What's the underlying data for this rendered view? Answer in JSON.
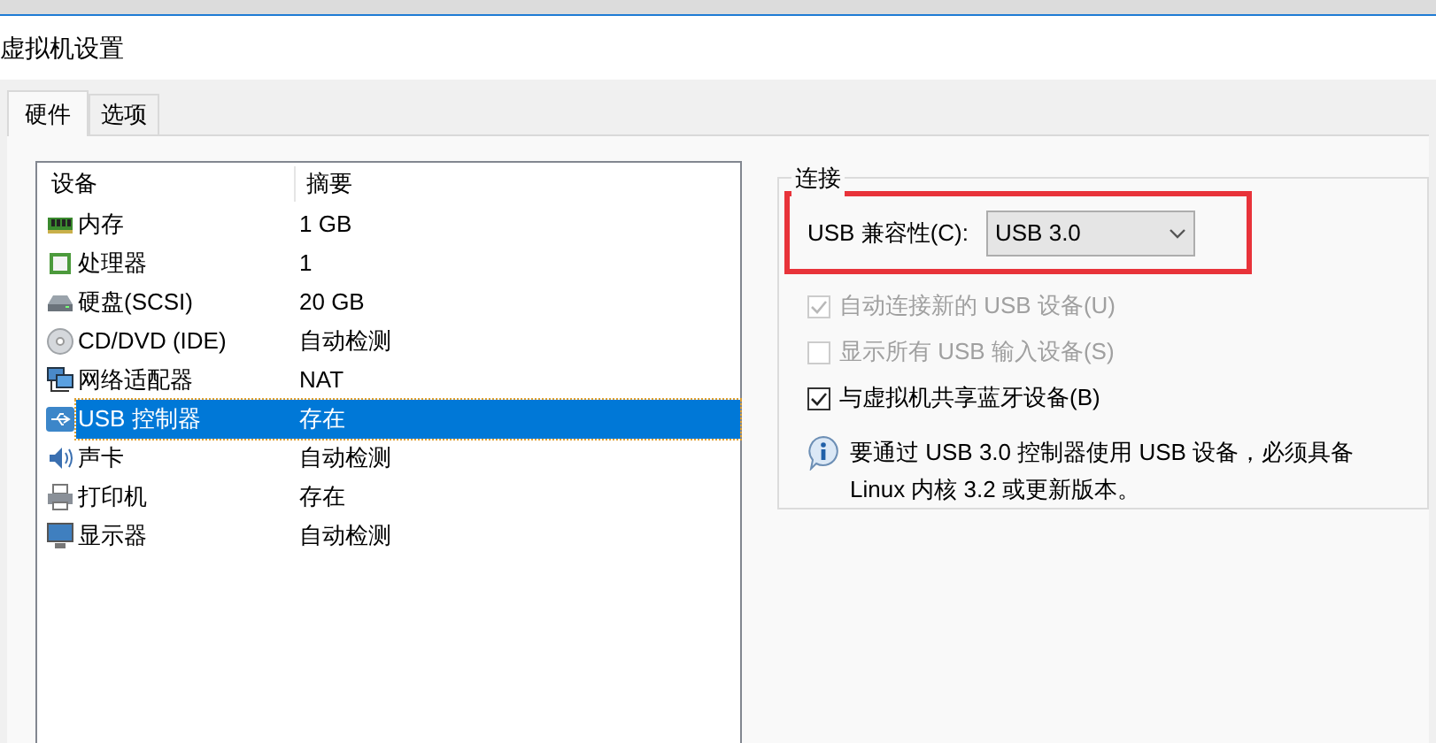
{
  "window": {
    "title": "虚拟机设置"
  },
  "tabs": [
    {
      "label": "硬件",
      "selected": true
    },
    {
      "label": "选项",
      "selected": false
    }
  ],
  "devices": {
    "columns": [
      "设备",
      "摘要"
    ],
    "rows": [
      {
        "kind": "memory",
        "name": "内存",
        "summary": "1 GB",
        "selected": false
      },
      {
        "kind": "cpu",
        "name": "处理器",
        "summary": "1",
        "selected": false
      },
      {
        "kind": "disk",
        "name": "硬盘(SCSI)",
        "summary": "20 GB",
        "selected": false
      },
      {
        "kind": "cdrom",
        "name": "CD/DVD (IDE)",
        "summary": "自动检测",
        "selected": false
      },
      {
        "kind": "network",
        "name": "网络适配器",
        "summary": "NAT",
        "selected": false
      },
      {
        "kind": "usb",
        "name": "USB 控制器",
        "summary": "存在",
        "selected": true
      },
      {
        "kind": "sound",
        "name": "声卡",
        "summary": "自动检测",
        "selected": false
      },
      {
        "kind": "printer",
        "name": "打印机",
        "summary": "存在",
        "selected": false
      },
      {
        "kind": "display",
        "name": "显示器",
        "summary": "自动检测",
        "selected": false
      }
    ]
  },
  "connection": {
    "legend": "连接",
    "compat_label": "USB 兼容性(C):",
    "compat_value": "USB 3.0",
    "options": [
      {
        "label": "自动连接新的 USB 设备(U)",
        "checked": true,
        "disabled": true
      },
      {
        "label": "显示所有 USB 输入设备(S)",
        "checked": false,
        "disabled": true
      },
      {
        "label": "与虚拟机共享蓝牙设备(B)",
        "checked": true,
        "disabled": false
      }
    ],
    "info": "要通过 USB 3.0 控制器使用 USB 设备，必须具备 Linux 内核 3.2 或更新版本。"
  }
}
